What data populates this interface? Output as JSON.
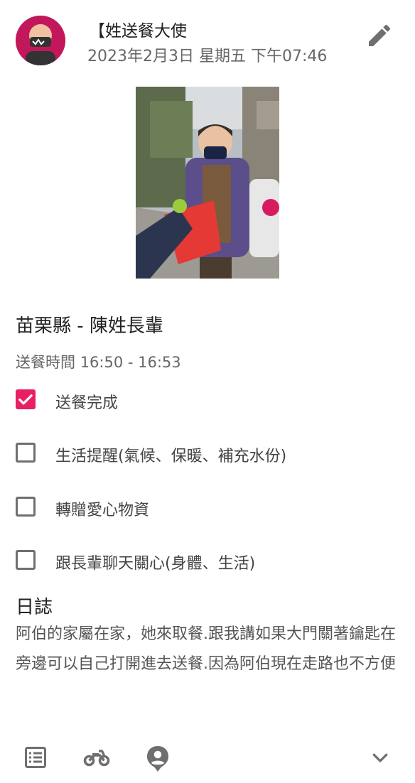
{
  "header": {
    "sender_name": "【姓送餐大使",
    "datetime": "2023年2月3日 星期五 下午07:46",
    "avatar_colors": {
      "bg": "#c2185b",
      "face": "#f2c1a3",
      "mask": "#333333"
    }
  },
  "photo": {
    "icon": "delivery-photo"
  },
  "record": {
    "elder_title": "苗栗縣 - 陳姓長輩",
    "time_label": "送餐時間",
    "time_range": "16:50 - 16:53"
  },
  "checklist": [
    {
      "label": "送餐完成",
      "checked": true
    },
    {
      "label": "生活提醒(氣候、保暖、補充水份)",
      "checked": false
    },
    {
      "label": "轉贈愛心物資",
      "checked": false
    },
    {
      "label": "跟長輩聊天關心(身體、生活)",
      "checked": false
    }
  ],
  "log": {
    "title": "日誌",
    "text": "阿伯的家屬在家，她來取餐.跟我講如果大門關著鑰匙在旁邊可以自己打開進去送餐.因為阿伯現在走路也不方便"
  },
  "bottom_nav": {
    "icons": [
      "list-icon",
      "motorcycle-icon",
      "person-pin-icon",
      "chevron-down-icon"
    ]
  },
  "colors": {
    "accent": "#e91e63",
    "icon_gray": "#6f6f6f",
    "text_secondary": "#666666"
  }
}
